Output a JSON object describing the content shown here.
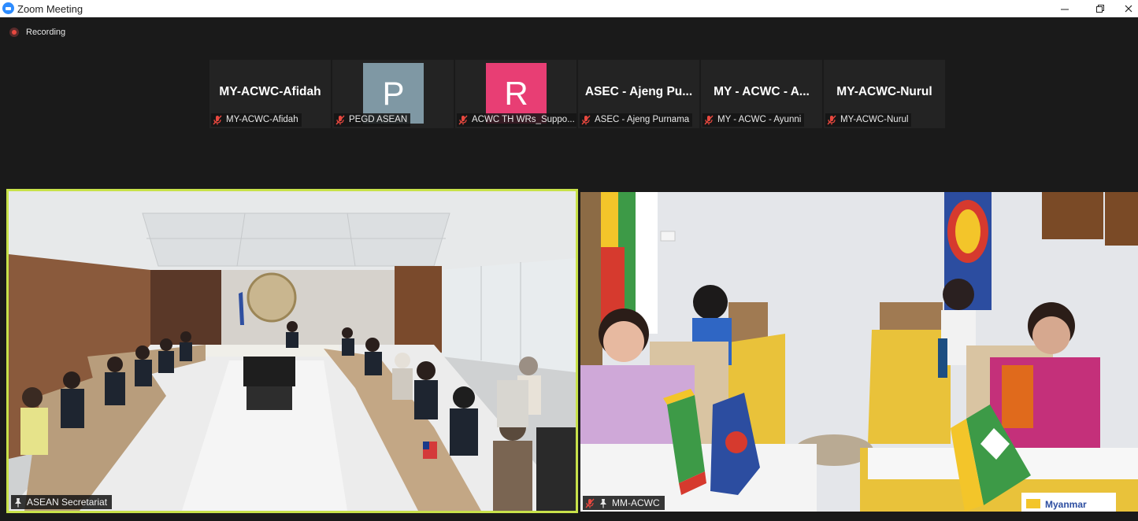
{
  "window": {
    "title": "Zoom Meeting"
  },
  "recording": {
    "label": "Recording"
  },
  "participants": [
    {
      "name": "MY-ACWC-Afidah",
      "display": "MY-ACWC-Afidah",
      "avatar": "",
      "color": ""
    },
    {
      "name": "PEGD ASEAN",
      "display": "",
      "avatar": "P",
      "color": "#7f98a4"
    },
    {
      "name": "ACWC TH WRs_Suppo...",
      "display": "",
      "avatar": "R",
      "color": "#e83e74"
    },
    {
      "name": "ASEC - Ajeng Purnama",
      "display": "ASEC - Ajeng Pu...",
      "avatar": "",
      "color": ""
    },
    {
      "name": "MY - ACWC - Ayunni",
      "display": "MY - ACWC - A...",
      "avatar": "",
      "color": ""
    },
    {
      "name": "MY-ACWC-Nurul",
      "display": "MY-ACWC-Nurul",
      "avatar": "",
      "color": ""
    }
  ],
  "videos": [
    {
      "name": "ASEAN Secretariat",
      "active_speaker": true
    },
    {
      "name": "MM-ACWC",
      "active_speaker": false,
      "sign_text": "Myanmar"
    }
  ],
  "colors": {
    "active_border": "#c8e24a",
    "muted_icon": "#e8483f",
    "avatar_p": "#7f98a4",
    "avatar_r": "#e83e74"
  }
}
